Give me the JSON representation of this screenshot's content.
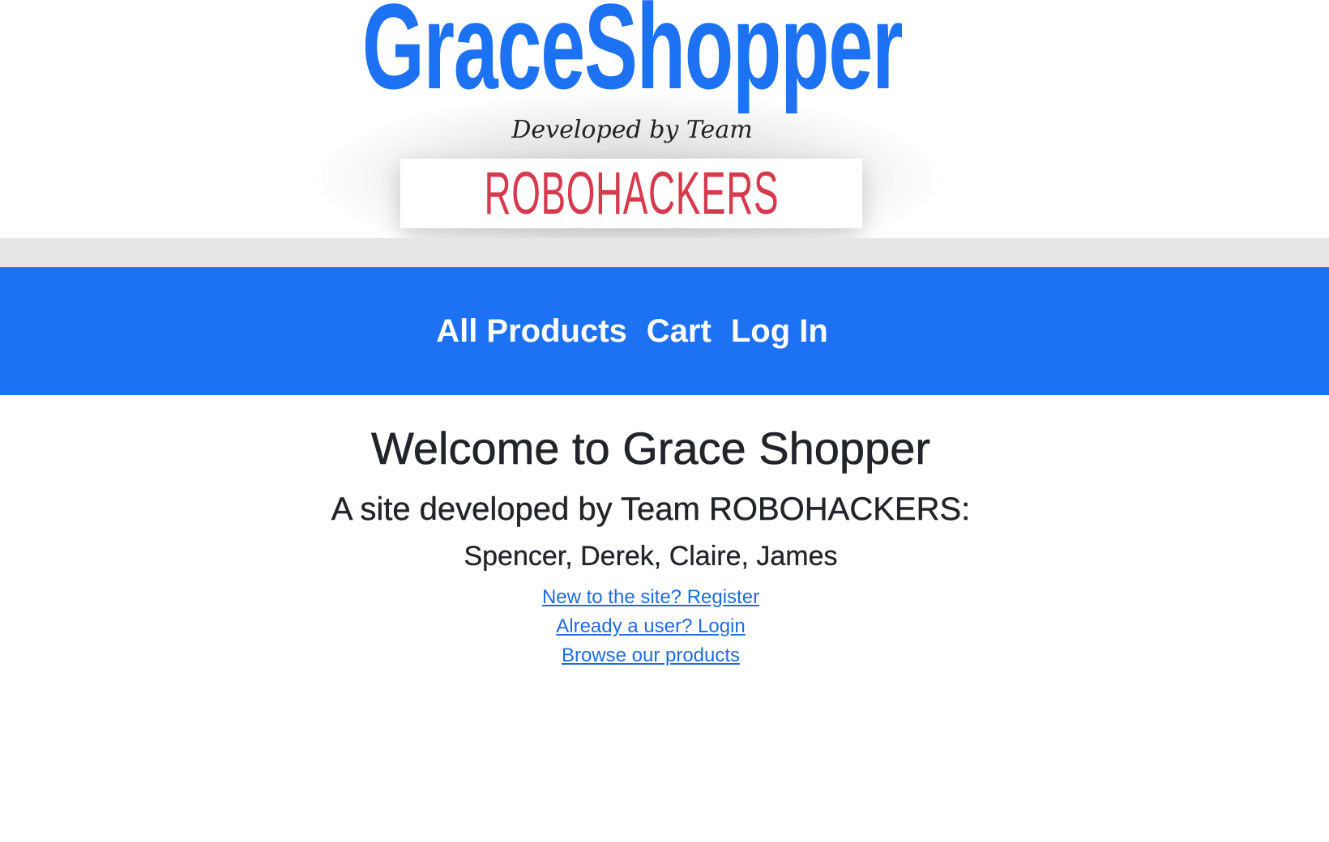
{
  "logo": {
    "title": "GraceShopper",
    "tagline": "Developed by Team",
    "team": "ROBOHACKERS"
  },
  "nav": {
    "items": [
      {
        "label": "All Products"
      },
      {
        "label": "Cart"
      },
      {
        "label": "Log In"
      }
    ]
  },
  "main": {
    "title": "Welcome to Grace Shopper",
    "subtitle": "A site developed by Team ROBOHACKERS:",
    "members": "Spencer, Derek, Claire, James",
    "links": [
      {
        "label": "New to the site? Register"
      },
      {
        "label": "Already a user? Login"
      },
      {
        "label": "Browse our products"
      }
    ]
  },
  "colors": {
    "brand": "#1d72f3",
    "team_red": "#d63a4c",
    "text": "#212529",
    "link": "#1d6ce0"
  }
}
